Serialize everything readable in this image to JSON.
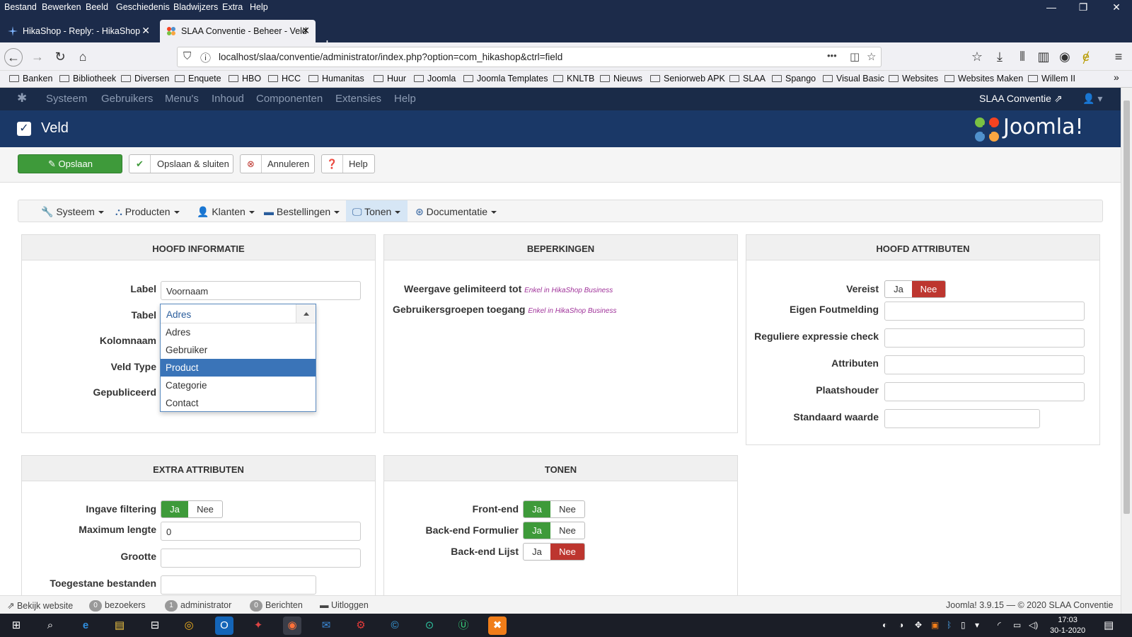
{
  "menubar": {
    "items": [
      "Bestand",
      "Bewerken",
      "Beeld",
      "Geschiedenis",
      "Bladwijzers",
      "Extra",
      "Help"
    ],
    "controls": [
      "—",
      "❐",
      "✕"
    ]
  },
  "tabs": [
    {
      "title": "HikaShop - Reply: - HikaShop",
      "active": false
    },
    {
      "title": "SLAA Conventie - Beheer - Veld",
      "active": true
    }
  ],
  "newtab_icon": "+",
  "address": {
    "url": "localhost/slaa/conventie/administrator/index.php?option=com_hikashop&ctrl=field"
  },
  "bookmarks": [
    "Banken",
    "Bibliotheek",
    "Diversen",
    "Enquete",
    "HBO",
    "HCC",
    "Humanitas",
    "Huur",
    "Joomla",
    "Joomla Templates",
    "KNLTB",
    "Nieuws",
    "Seniorweb APK",
    "SLAA",
    "Spango",
    "Visual Basic",
    "Websites",
    "Websites Maken",
    "Willem II"
  ],
  "joomla": {
    "menu": [
      "Systeem",
      "Gebruikers",
      "Menu's",
      "Inhoud",
      "Componenten",
      "Extensies",
      "Help"
    ],
    "site_link": "SLAA Conventie",
    "page_title": "Veld",
    "logo_text": "Joomla!"
  },
  "toolbar": {
    "save": "Opslaan",
    "save_close": "Opslaan & sluiten",
    "cancel": "Annuleren",
    "help": "Help"
  },
  "submenu": [
    {
      "label": "Systeem",
      "icon": "wrench-icon"
    },
    {
      "label": "Producten",
      "icon": "cubes-icon"
    },
    {
      "label": "Klanten",
      "icon": "user-icon"
    },
    {
      "label": "Bestellingen",
      "icon": "credit-card-icon"
    },
    {
      "label": "Tonen",
      "icon": "monitor-icon",
      "active": true
    },
    {
      "label": "Documentatie",
      "icon": "lifebuoy-icon"
    }
  ],
  "hoofd_informatie": {
    "title": "HOOFD INFORMATIE",
    "label_label": "Label",
    "label_value": "Voornaam",
    "tabel_label": "Tabel",
    "kolomnaam_label": "Kolomnaam",
    "veldtype_label": "Veld Type",
    "gepubliceerd_label": "Gepubliceerd",
    "tabel_dropdown": {
      "selected": "Adres",
      "options": [
        "Adres",
        "Gebruiker",
        "Product",
        "Categorie",
        "Contact"
      ],
      "highlighted": "Product"
    }
  },
  "beperkingen": {
    "title": "BEPERKINGEN",
    "weergave_label": "Weergave gelimiteerd tot",
    "groepen_label": "Gebruikersgroepen toegang",
    "business_note": "Enkel in HikaShop Business"
  },
  "hoofd_attributen": {
    "title": "HOOFD ATTRIBUTEN",
    "vereist_label": "Vereist",
    "foutmelding_label": "Eigen Foutmelding",
    "regex_label": "Reguliere expressie check",
    "attributen_label": "Attributen",
    "plaatshouder_label": "Plaatshouder",
    "standaard_label": "Standaard waarde"
  },
  "extra_attributen": {
    "title": "EXTRA ATTRIBUTEN",
    "filtering_label": "Ingave filtering",
    "maxlengte_label": "Maximum lengte",
    "maxlengte_value": "0",
    "grootte_label": "Grootte",
    "bestanden_label": "Toegestane bestanden"
  },
  "tonen": {
    "title": "TONEN",
    "frontend_label": "Front-end",
    "backend_form_label": "Back-end Formulier",
    "backend_list_label": "Back-end Lijst"
  },
  "toggle": {
    "yes": "Ja",
    "no": "Nee"
  },
  "statusbar": {
    "view_site": "Bekijk website",
    "visitors_count": "0",
    "visitors_label": "bezoekers",
    "admin_count": "1",
    "admin_label": "administrator",
    "messages_count": "0",
    "messages_label": "Berichten",
    "logout": "Uitloggen",
    "version": "Joomla! 3.9.15 — © 2020 SLAA Conventie"
  },
  "clock": {
    "time": "17:03",
    "date": "30-1-2020"
  },
  "colors": {
    "accent_green": "#3e9a3a",
    "accent_red": "#bd362f",
    "joomla_blue": "#1a3867",
    "selected_option": "#3a74b8"
  }
}
